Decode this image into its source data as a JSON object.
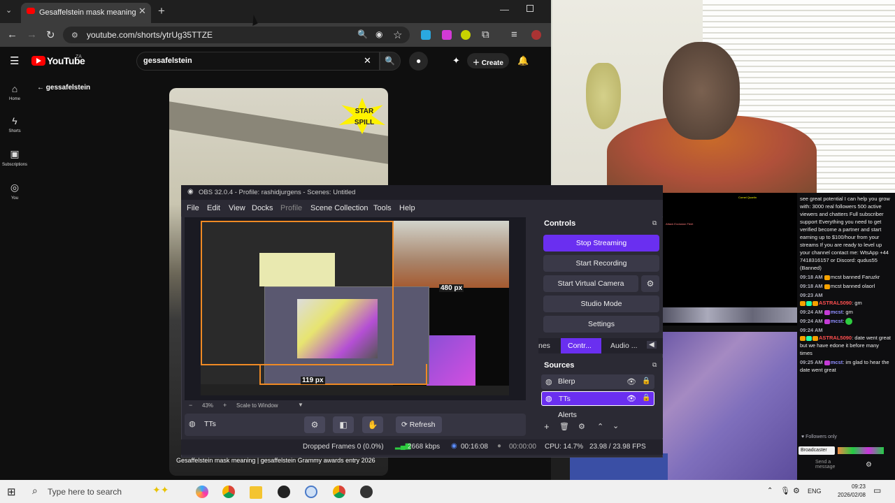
{
  "browser": {
    "tab_title": "Gesaffelstein mask meaning",
    "url": "youtube.com/shorts/ytrUg35TTZE"
  },
  "youtube": {
    "logo_text": "YouTube",
    "region": "ZA",
    "search_query": "gessafelstein",
    "create_label": "Create",
    "sidebar": [
      {
        "label": "Home"
      },
      {
        "label": "Shorts"
      },
      {
        "label": "Subscriptions"
      },
      {
        "label": "You"
      }
    ],
    "back_label": "gessafelstein",
    "short_overlay": "STAR SPILL",
    "short_caption": "Gesaffelstein mask meaning | gesaffelstein Grammy awards entry 2026"
  },
  "obs": {
    "title": "OBS 32.0.4 - Profile: rashidjurgens - Scenes: Untitled",
    "menu": [
      "File",
      "Edit",
      "View",
      "Docks",
      "Profile",
      "Scene Collection",
      "Tools",
      "Help"
    ],
    "preview_labels": {
      "width": "480 px",
      "height": "119 px"
    },
    "zoom": "43%",
    "scale_mode": "Scale to Window",
    "source_name": "TTs",
    "refresh_label": "Refresh",
    "controls_title": "Controls",
    "controls": [
      "Stop Streaming",
      "Start Recording",
      "Start Virtual Camera",
      "Studio Mode",
      "Settings"
    ],
    "dock_tabs": [
      "nes",
      "Contr...",
      "Audio ..."
    ],
    "sources_title": "Sources",
    "sources": [
      "Blerp",
      "TTs",
      "Alerts"
    ],
    "status": {
      "dropped": "Dropped Frames 0 (0.0%)",
      "bitrate": "2668 kbps",
      "stream_time": "00:16:08",
      "rec_time": "00:00:00",
      "cpu": "CPU: 14.7%",
      "fps": "23.98 / 23.98 FPS"
    }
  },
  "chat": {
    "top_message": "see great potential I can help you grow with: 3000 real followers 500 active viewers and chatters Full subscriber support Everything you need to get verified become a partner and start earning up to $100/hour from your streams If you are ready to level up your channel contact me: WtsApp +44 7418316157 or Discord: qudus55 (Banned)",
    "lines": [
      {
        "time": "09:18 AM",
        "user": "",
        "text": "mcst banned Faruzkr"
      },
      {
        "time": "09:18 AM",
        "user": "",
        "text": "mcst banned olaorl"
      },
      {
        "time": "09:23 AM",
        "user": "ASTRAL5090",
        "text": ": gm"
      },
      {
        "time": "09:24 AM",
        "user": "mcst",
        "text": ": gm"
      },
      {
        "time": "09:24 AM",
        "user": "mcst",
        "text": ":"
      },
      {
        "time": "09:24 AM",
        "user": "ASTRAL5090",
        "text": ": date went great but we have edone it before many times"
      },
      {
        "time": "09:25 AM",
        "user": "mcst",
        "text": ": im glad to hear the date went great"
      }
    ],
    "followers_only": "Followers only",
    "broadcaster_tooltip": "Broadcaster",
    "send_placeholder": "Send a message",
    "game_text1": "Attack Exclusion Fleet",
    "game_text2": "Cornel Quartin"
  },
  "taskbar": {
    "search_placeholder": "Type here to search",
    "lang": "ENG",
    "time": "09:23",
    "date": "2026/02/08"
  },
  "colors": {
    "accent": "#6a2ff0",
    "youtube_red": "#ff0000",
    "obs_selection": "#f08a24"
  }
}
